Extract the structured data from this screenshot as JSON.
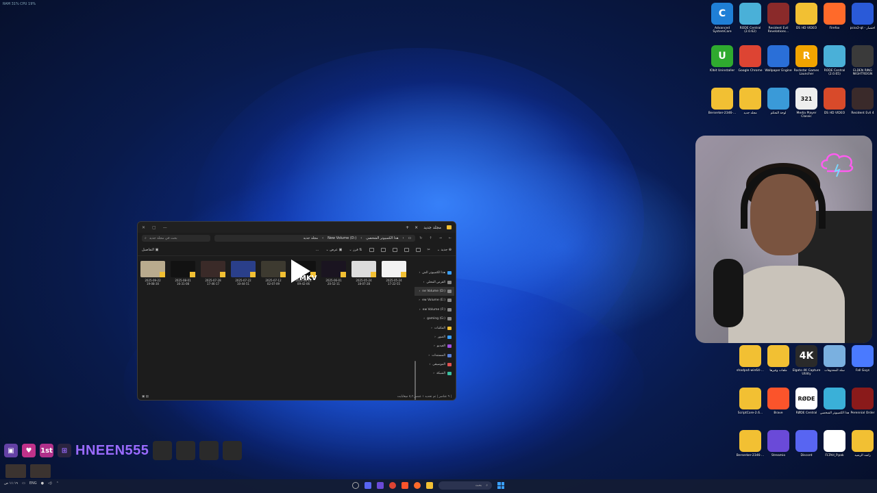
{
  "overlay": {
    "stats": "RAM 31%  CPU 19%"
  },
  "explorer": {
    "tab_title": "مجلد جديد",
    "add_tab": "+",
    "close_tab": "×",
    "search_placeholder": "بحث في مجلد جديد",
    "path": [
      "هذا الكمبيوتر الشخصي",
      "New Volume (D:)",
      "مجلد جديد"
    ],
    "toolbar": {
      "new": "جديد",
      "sort": "فرز",
      "view": "عرض",
      "more": "...",
      "details": "التفاصيل"
    },
    "files": [
      {
        "date": "2025-09-22",
        "time": "19-08-30",
        "color": "#b9ab8e"
      },
      {
        "date": "2025-08-01",
        "time": "16-31-08",
        "color": "#121212"
      },
      {
        "date": "2025-07-28",
        "time": "17-46-17",
        "color": "#3a2a28"
      },
      {
        "date": "2025-07-22",
        "time": "10-44-51",
        "color": "#2a3f8a"
      },
      {
        "date": "2025-07-12",
        "time": "02-07-09",
        "color": "#3d3a30"
      },
      {
        "date": "2025-06-14",
        "time": "09-42-06",
        "color": "mkv"
      },
      {
        "date": "2025-06-01",
        "time": "20-52-11",
        "color": "#1a1420"
      },
      {
        "date": "2025-05-24",
        "time": "18-07-28",
        "color": "#dcdcdc"
      },
      {
        "date": "2025-05-24",
        "time": "17-22-55",
        "color": "#f2f2f2"
      }
    ],
    "mkv_label": "MKV",
    "sidebar": [
      {
        "label": "هذا الكمبيوتر الش",
        "icon": "#3aa0ff",
        "active": false
      },
      {
        "label": "القرص المحلي",
        "icon": "#888",
        "active": false
      },
      {
        "label": "ne Volume (D:)",
        "icon": "#888",
        "active": true
      },
      {
        "label": "ew Volume (E:)",
        "icon": "#888",
        "active": false
      },
      {
        "label": "ew Volume (F:)",
        "icon": "#888",
        "active": false
      },
      {
        "label": "gaming (G:)",
        "icon": "#888",
        "active": false
      },
      {
        "label": "المكتبات",
        "icon": "#f2c033",
        "active": false
      },
      {
        "label": "الصور",
        "icon": "#3aa0ff",
        "active": false
      },
      {
        "label": "الفيديو",
        "icon": "#a050e0",
        "active": false
      },
      {
        "label": "المستندات",
        "icon": "#5a7fd8",
        "active": false
      },
      {
        "label": "الموسيقى",
        "icon": "#e05050",
        "active": false
      },
      {
        "label": "الشبكة",
        "icon": "#3ac0a0",
        "active": false
      }
    ],
    "status_left": "٩ عناصر  |  تم تحديد ١ عنصر ٥٫٦ ميغابايت  |",
    "status_right": ""
  },
  "desktop": {
    "icons": [
      {
        "label": "Advanced SystemCare",
        "glyph": "C",
        "color": "#1f7fd6"
      },
      {
        "label": "RODE Central (2.0.62)",
        "glyph": "",
        "color": "#4ab0d8"
      },
      {
        "label": "Resident Evil Revelations...",
        "glyph": "",
        "color": "#8a2a2a"
      },
      {
        "label": "DS HD VIDEO",
        "glyph": "",
        "color": "#f2c033"
      },
      {
        "label": "Firefox",
        "glyph": "",
        "color": "#ff6a2a"
      },
      {
        "label": "pcsx2-qt - اختصار",
        "glyph": "",
        "color": "#2a5ad8"
      },
      {
        "label": "IObit Uninstaller",
        "glyph": "U",
        "color": "#2faa2f"
      },
      {
        "label": "Google Chrome",
        "glyph": "",
        "color": "#dd4433"
      },
      {
        "label": "Wallpaper Engine",
        "glyph": "",
        "color": "#2a6fd8"
      },
      {
        "label": "Rockstar Games Launcher",
        "glyph": "R",
        "color": "#f2a400"
      },
      {
        "label": "RODE Central (2.0.65)",
        "glyph": "",
        "color": "#4ab0d8"
      },
      {
        "label": "ELDEN RING NIGHTREIGN",
        "glyph": "",
        "color": "#3a3a3a"
      },
      {
        "label": "Berserker-2346-...",
        "glyph": "",
        "color": "#f2c033"
      },
      {
        "label": "مجلد جديد",
        "glyph": "",
        "color": "#f2c033"
      },
      {
        "label": "لوحة التحكم",
        "glyph": "",
        "color": "#3a9ad8"
      },
      {
        "label": "Media Player Classic",
        "glyph": "321",
        "color": "#eeeeee"
      },
      {
        "label": "DS HD VIDEO",
        "glyph": "",
        "color": "#d84a2a"
      },
      {
        "label": "Resident Evil 4",
        "glyph": "",
        "color": "#3a2a2a"
      },
      {
        "label": "shadps4-win64-...",
        "glyph": "",
        "color": "#f2c033"
      },
      {
        "label": "ملفات وغيرها",
        "glyph": "",
        "color": "#f2c033"
      },
      {
        "label": "Elgato 4K Capture Utility",
        "glyph": "4K",
        "color": "#2a2a2a"
      },
      {
        "label": "سلة المحذوفات",
        "glyph": "",
        "color": "#7ab0e0"
      },
      {
        "label": "Fall Guys",
        "glyph": "",
        "color": "#4a7aff"
      },
      {
        "label": "ScriptCore-2.6...",
        "glyph": "",
        "color": "#f2c033"
      },
      {
        "label": "Brave",
        "glyph": "",
        "color": "#fb542b"
      },
      {
        "label": "RØDE Central",
        "glyph": "RØDE",
        "color": "#ffffff"
      },
      {
        "label": "هذا الكمبيوتر الشخصي",
        "glyph": "",
        "color": "#3ab0d8"
      },
      {
        "label": "Perennial Order",
        "glyph": "",
        "color": "#8a1a1a"
      },
      {
        "label": "Berserker-2346-...",
        "glyph": "",
        "color": "#f2c033"
      },
      {
        "label": "Streamio",
        "glyph": "",
        "color": "#6a4ad8"
      },
      {
        "label": "Discord",
        "glyph": "",
        "color": "#5865f2"
      },
      {
        "label": "FLTAH_P.pak",
        "glyph": "",
        "color": "#ffffff"
      },
      {
        "label": "راشد الرشيد",
        "glyph": "",
        "color": "#f2c033"
      }
    ]
  },
  "stream": {
    "channel": "HNEEN555",
    "badge_first": "1st"
  },
  "taskbar": {
    "search_placeholder": "بحث",
    "lang": "ENG",
    "time": "١١:١٩ ص",
    "date": "٢٠٢٥/٩/٢٤"
  }
}
